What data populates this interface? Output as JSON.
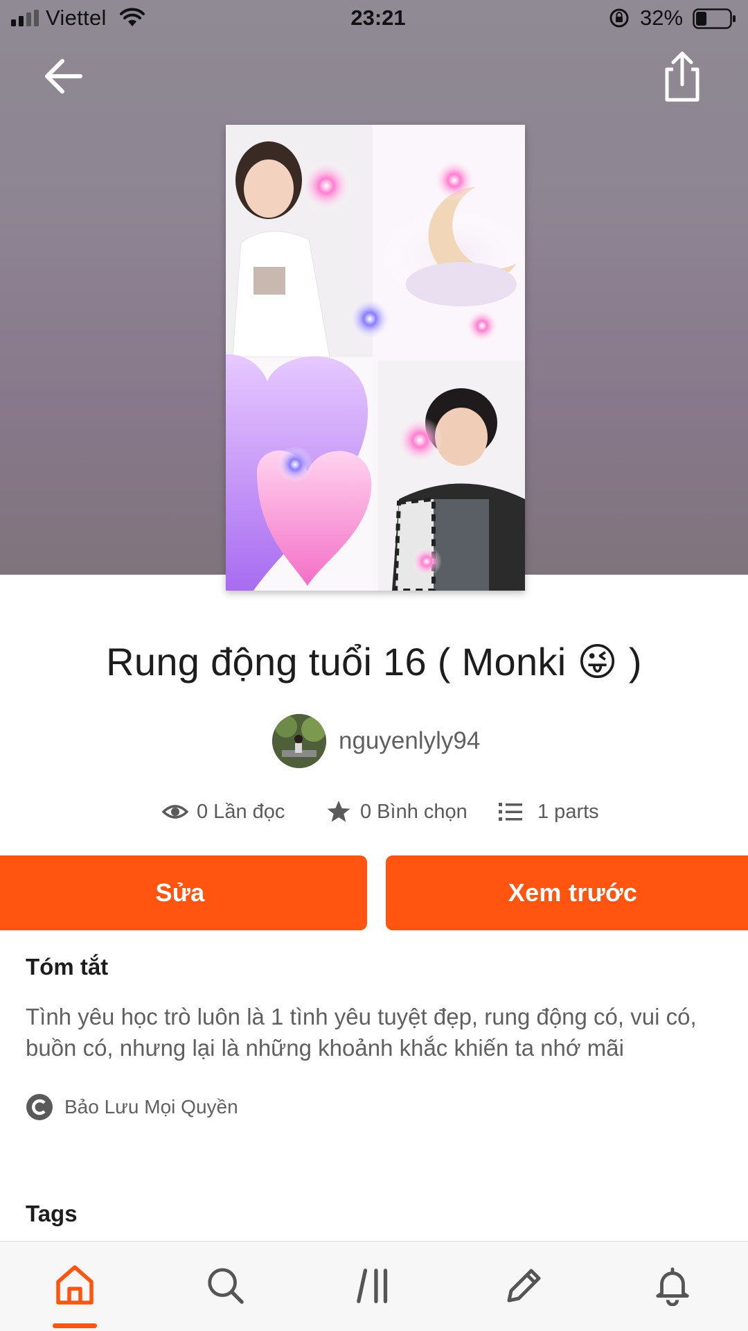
{
  "status_bar": {
    "carrier": "Viettel",
    "time": "23:21",
    "battery": "32%",
    "battery_level": 0.32
  },
  "header": {
    "back_icon": "arrow-left-icon",
    "share_icon": "share-icon"
  },
  "story": {
    "title": "Rung động tuổi 16 ( Monki 😜 )",
    "author": "nguyenlyly94",
    "stats": {
      "reads": "0 Lần đọc",
      "votes": "0 Bình chọn",
      "parts": "1 parts"
    }
  },
  "actions": {
    "edit_label": "Sửa",
    "preview_label": "Xem trước"
  },
  "summary": {
    "heading": "Tóm tắt",
    "text": "Tình yêu học trò luôn là 1 tình yêu tuyệt đẹp, rung động có, vui có, buồn có, nhưng lại là những khoảnh khắc khiến ta nhớ mãi",
    "copyright": "Bảo Lưu Mọi Quyền"
  },
  "tags": {
    "heading": "Tags"
  },
  "bottom_nav": {
    "items": [
      "home-icon",
      "search-icon",
      "library-icon",
      "write-icon",
      "notification-bell-icon"
    ],
    "active": "home-icon",
    "accent_color": "#ff5510"
  }
}
